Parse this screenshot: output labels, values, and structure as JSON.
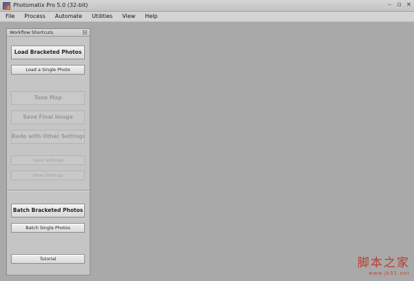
{
  "window": {
    "title": "Photomatix Pro 5.0 (32-bit)",
    "minimize_glyph": "–",
    "restore_glyph": "▫",
    "close_glyph": "×"
  },
  "menu": {
    "items": [
      "File",
      "Process",
      "Automate",
      "Utilities",
      "View",
      "Help"
    ]
  },
  "panel": {
    "title": "Workflow Shortcuts",
    "buttons": {
      "load_bracketed": "Load Bracketed Photos",
      "load_single": "Load a Single Photo",
      "tone_map": "Tone Map",
      "save_final": "Save Final Image",
      "redo_settings": "Redo with Other Settings",
      "save_settings": "Save Settings",
      "view_settings": "View Settings",
      "batch_bracketed": "Batch Bracketed Photos",
      "batch_single": "Batch Single Photos",
      "tutorial": "Tutorial"
    }
  },
  "watermark": {
    "chinese": "脚本之家",
    "url": "www.jb51.net"
  }
}
